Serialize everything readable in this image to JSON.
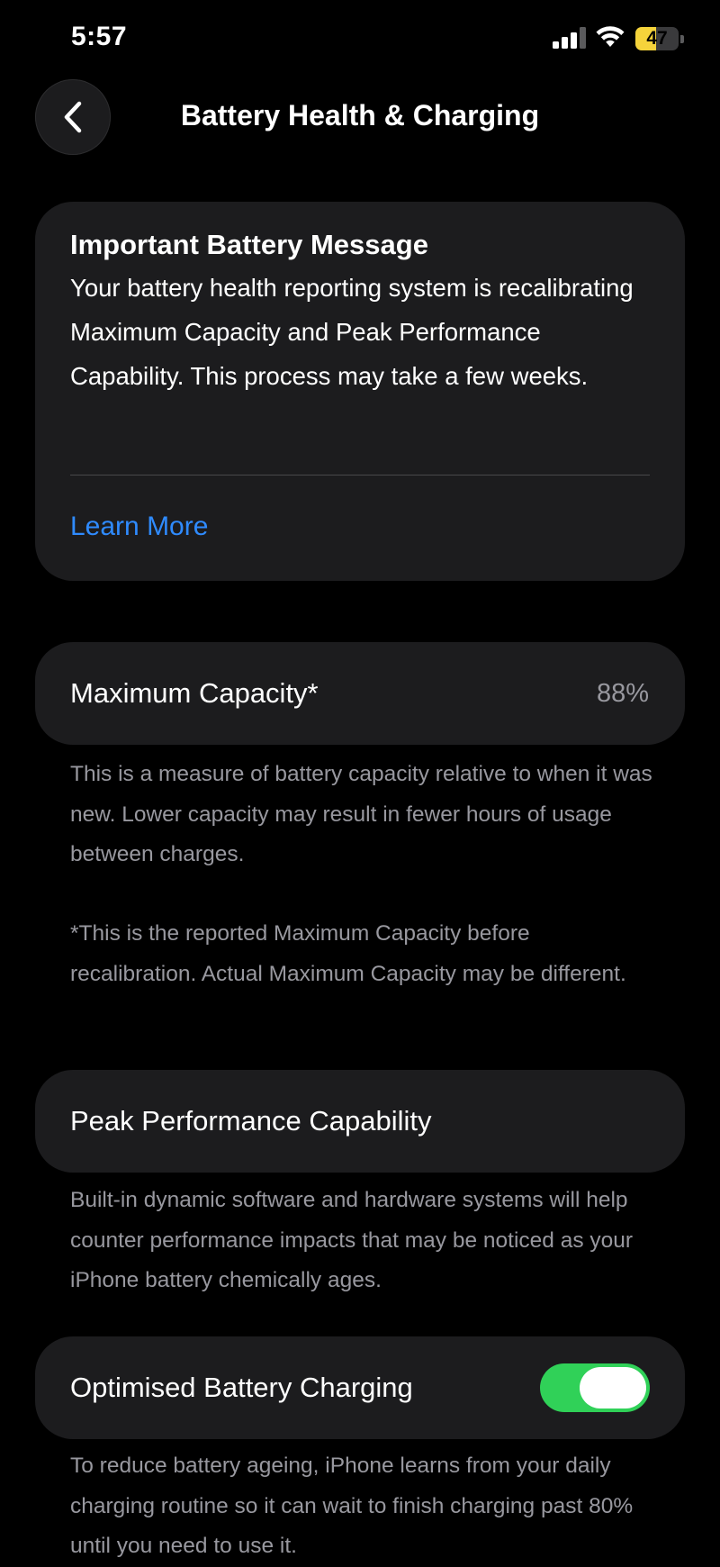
{
  "status_bar": {
    "time": "5:57",
    "battery_level": "47",
    "battery_fill_fraction": 0.47,
    "icons": [
      "cellular-signal-icon",
      "wifi-icon",
      "battery-icon"
    ]
  },
  "nav": {
    "back_icon": "chevron-left-icon",
    "title": "Battery Health & Charging"
  },
  "battery_message": {
    "title": "Important Battery Message",
    "body": "Your battery health reporting system is recalibrating Maximum Capacity and Peak Performance Capability. This process may take a few weeks.",
    "link_label": "Learn More"
  },
  "maximum_capacity": {
    "label": "Maximum Capacity*",
    "value": "88%",
    "description": "This is a measure of battery capacity relative to when it was new. Lower capacity may result in fewer hours of usage between charges.",
    "footnote": "*This is the reported Maximum Capacity before recalibration. Actual Maximum Capacity may be different."
  },
  "peak_performance": {
    "label": "Peak Performance Capability",
    "description": "Built-in dynamic software and hardware systems will help counter performance impacts that may be noticed as your iPhone battery chemically ages."
  },
  "optimised_charging": {
    "label": "Optimised Battery Charging",
    "enabled": true,
    "description": "To reduce battery ageing, iPhone learns from your daily charging routine so it can wait to finish charging past 80% until you need to use it."
  },
  "colors": {
    "background": "#000000",
    "card": "#1c1c1e",
    "link": "#2f8bff",
    "secondary_text": "#98989f",
    "toggle_on": "#30d158",
    "battery_yellow": "#f5d33b"
  }
}
